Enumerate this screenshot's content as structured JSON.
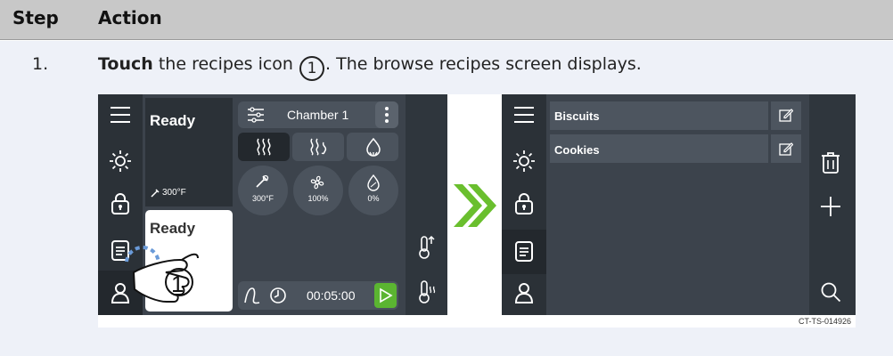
{
  "table": {
    "header_step": "Step",
    "header_action": "Action",
    "row1": {
      "step": "1.",
      "action_bold": "Touch",
      "action_pre": " the recipes icon ",
      "callout": "1",
      "action_post": ". The browse recipes screen displays."
    }
  },
  "left_screen": {
    "status_top": "Ready",
    "temp_top": "300°F",
    "status_bottom": "Ready",
    "chamber_label": "Chamber 1",
    "dial_temp": "300°F",
    "dial_fan": "100%",
    "dial_humidity": "0%",
    "timer": "00:05:00",
    "callout": "1"
  },
  "right_screen": {
    "recipes": [
      "Biscuits",
      "Cookies"
    ]
  },
  "figure_code": "CT-TS-014926",
  "colors": {
    "accent_green": "#6abf2e",
    "screen_bg": "#3c434c",
    "rail_bg": "#2b3137"
  }
}
